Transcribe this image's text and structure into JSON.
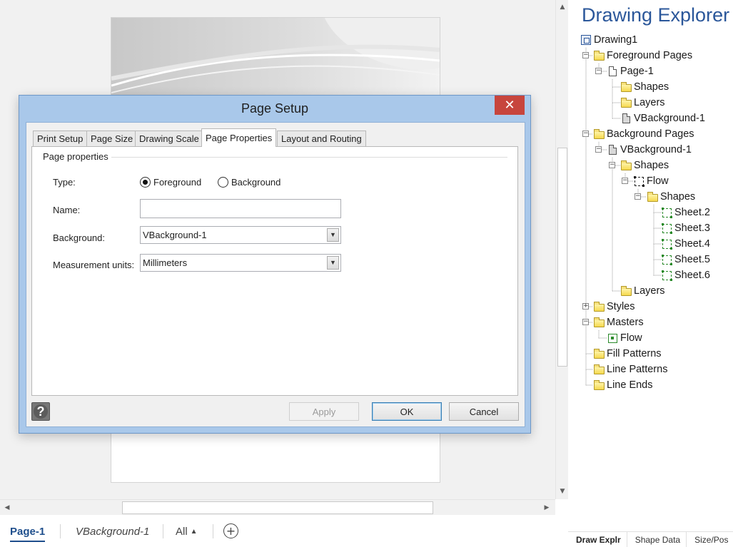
{
  "page_tabs": {
    "items": [
      "Page-1",
      "VBackground-1",
      "All"
    ],
    "add_page_symbol": "+"
  },
  "scroll": {
    "up": "▲",
    "down": "▼",
    "left": "◀",
    "right": "▶"
  },
  "explorer": {
    "title": "Drawing Explorer",
    "tree": [
      {
        "label": "Drawing1",
        "icon": "drawing-icon"
      },
      {
        "label": "Foreground Pages",
        "icon": "folder-icon"
      },
      {
        "label": "Page-1",
        "icon": "page-icon"
      },
      {
        "label": "Shapes",
        "icon": "folder-icon"
      },
      {
        "label": "Layers",
        "icon": "folder-icon"
      },
      {
        "label": "VBackground-1",
        "icon": "background-page-icon"
      },
      {
        "label": "Background Pages",
        "icon": "folder-icon"
      },
      {
        "label": "VBackground-1",
        "icon": "background-page-icon"
      },
      {
        "label": "Shapes",
        "icon": "folder-icon"
      },
      {
        "label": "Flow",
        "icon": "group-shape-icon"
      },
      {
        "label": "Shapes",
        "icon": "folder-icon"
      },
      {
        "label": "Sheet.2",
        "icon": "shape-icon"
      },
      {
        "label": "Sheet.3",
        "icon": "shape-icon"
      },
      {
        "label": "Sheet.4",
        "icon": "shape-icon"
      },
      {
        "label": "Sheet.5",
        "icon": "shape-icon"
      },
      {
        "label": "Sheet.6",
        "icon": "shape-icon"
      },
      {
        "label": "Layers",
        "icon": "folder-icon"
      },
      {
        "label": "Styles",
        "icon": "folder-icon"
      },
      {
        "label": "Masters",
        "icon": "folder-icon"
      },
      {
        "label": "Flow",
        "icon": "master-icon"
      },
      {
        "label": "Fill Patterns",
        "icon": "folder-icon"
      },
      {
        "label": "Line Patterns",
        "icon": "folder-icon"
      },
      {
        "label": "Line Ends",
        "icon": "folder-icon"
      }
    ],
    "bottom_tabs": [
      "Draw Explr",
      "Shape Data",
      "Size/Pos"
    ]
  },
  "dialog": {
    "title": "Page Setup",
    "close_symbol": "✕",
    "tabs": [
      "Print Setup",
      "Page Size",
      "Drawing Scale",
      "Page Properties",
      "Layout and Routing"
    ],
    "active_tab": "Page Properties",
    "group_label": "Page properties",
    "fields": {
      "type_label": "Type:",
      "type_options": [
        "Foreground",
        "Background"
      ],
      "type_selected": "Foreground",
      "name_label": "Name:",
      "name_value": "",
      "background_label": "Background:",
      "background_value": "VBackground-1",
      "units_label": "Measurement units:",
      "units_value": "Millimeters"
    },
    "buttons": {
      "help": "?",
      "apply": "Apply",
      "ok": "OK",
      "cancel": "Cancel"
    }
  },
  "colors": {
    "accent": "#2b579a",
    "dialog_frame": "#a9c8ea",
    "close_button": "#c7453d"
  }
}
